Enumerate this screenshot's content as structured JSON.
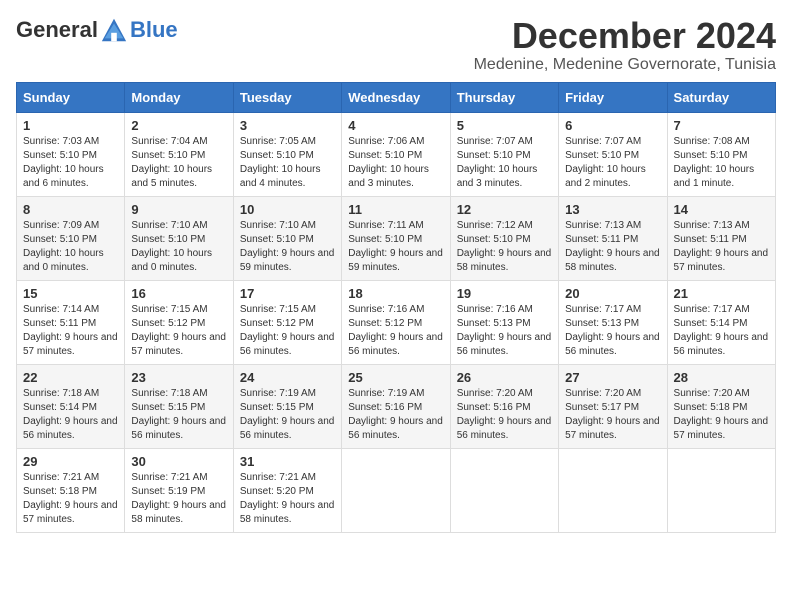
{
  "logo": {
    "general": "General",
    "blue": "Blue"
  },
  "header": {
    "month": "December 2024",
    "location": "Medenine, Medenine Governorate, Tunisia"
  },
  "weekdays": [
    "Sunday",
    "Monday",
    "Tuesday",
    "Wednesday",
    "Thursday",
    "Friday",
    "Saturday"
  ],
  "weeks": [
    [
      {
        "day": "1",
        "sunrise": "7:03 AM",
        "sunset": "5:10 PM",
        "daylight": "10 hours and 6 minutes."
      },
      {
        "day": "2",
        "sunrise": "7:04 AM",
        "sunset": "5:10 PM",
        "daylight": "10 hours and 5 minutes."
      },
      {
        "day": "3",
        "sunrise": "7:05 AM",
        "sunset": "5:10 PM",
        "daylight": "10 hours and 4 minutes."
      },
      {
        "day": "4",
        "sunrise": "7:06 AM",
        "sunset": "5:10 PM",
        "daylight": "10 hours and 3 minutes."
      },
      {
        "day": "5",
        "sunrise": "7:07 AM",
        "sunset": "5:10 PM",
        "daylight": "10 hours and 3 minutes."
      },
      {
        "day": "6",
        "sunrise": "7:07 AM",
        "sunset": "5:10 PM",
        "daylight": "10 hours and 2 minutes."
      },
      {
        "day": "7",
        "sunrise": "7:08 AM",
        "sunset": "5:10 PM",
        "daylight": "10 hours and 1 minute."
      }
    ],
    [
      {
        "day": "8",
        "sunrise": "7:09 AM",
        "sunset": "5:10 PM",
        "daylight": "10 hours and 0 minutes."
      },
      {
        "day": "9",
        "sunrise": "7:10 AM",
        "sunset": "5:10 PM",
        "daylight": "10 hours and 0 minutes."
      },
      {
        "day": "10",
        "sunrise": "7:10 AM",
        "sunset": "5:10 PM",
        "daylight": "9 hours and 59 minutes."
      },
      {
        "day": "11",
        "sunrise": "7:11 AM",
        "sunset": "5:10 PM",
        "daylight": "9 hours and 59 minutes."
      },
      {
        "day": "12",
        "sunrise": "7:12 AM",
        "sunset": "5:10 PM",
        "daylight": "9 hours and 58 minutes."
      },
      {
        "day": "13",
        "sunrise": "7:13 AM",
        "sunset": "5:11 PM",
        "daylight": "9 hours and 58 minutes."
      },
      {
        "day": "14",
        "sunrise": "7:13 AM",
        "sunset": "5:11 PM",
        "daylight": "9 hours and 57 minutes."
      }
    ],
    [
      {
        "day": "15",
        "sunrise": "7:14 AM",
        "sunset": "5:11 PM",
        "daylight": "9 hours and 57 minutes."
      },
      {
        "day": "16",
        "sunrise": "7:15 AM",
        "sunset": "5:12 PM",
        "daylight": "9 hours and 57 minutes."
      },
      {
        "day": "17",
        "sunrise": "7:15 AM",
        "sunset": "5:12 PM",
        "daylight": "9 hours and 56 minutes."
      },
      {
        "day": "18",
        "sunrise": "7:16 AM",
        "sunset": "5:12 PM",
        "daylight": "9 hours and 56 minutes."
      },
      {
        "day": "19",
        "sunrise": "7:16 AM",
        "sunset": "5:13 PM",
        "daylight": "9 hours and 56 minutes."
      },
      {
        "day": "20",
        "sunrise": "7:17 AM",
        "sunset": "5:13 PM",
        "daylight": "9 hours and 56 minutes."
      },
      {
        "day": "21",
        "sunrise": "7:17 AM",
        "sunset": "5:14 PM",
        "daylight": "9 hours and 56 minutes."
      }
    ],
    [
      {
        "day": "22",
        "sunrise": "7:18 AM",
        "sunset": "5:14 PM",
        "daylight": "9 hours and 56 minutes."
      },
      {
        "day": "23",
        "sunrise": "7:18 AM",
        "sunset": "5:15 PM",
        "daylight": "9 hours and 56 minutes."
      },
      {
        "day": "24",
        "sunrise": "7:19 AM",
        "sunset": "5:15 PM",
        "daylight": "9 hours and 56 minutes."
      },
      {
        "day": "25",
        "sunrise": "7:19 AM",
        "sunset": "5:16 PM",
        "daylight": "9 hours and 56 minutes."
      },
      {
        "day": "26",
        "sunrise": "7:20 AM",
        "sunset": "5:16 PM",
        "daylight": "9 hours and 56 minutes."
      },
      {
        "day": "27",
        "sunrise": "7:20 AM",
        "sunset": "5:17 PM",
        "daylight": "9 hours and 57 minutes."
      },
      {
        "day": "28",
        "sunrise": "7:20 AM",
        "sunset": "5:18 PM",
        "daylight": "9 hours and 57 minutes."
      }
    ],
    [
      {
        "day": "29",
        "sunrise": "7:21 AM",
        "sunset": "5:18 PM",
        "daylight": "9 hours and 57 minutes."
      },
      {
        "day": "30",
        "sunrise": "7:21 AM",
        "sunset": "5:19 PM",
        "daylight": "9 hours and 58 minutes."
      },
      {
        "day": "31",
        "sunrise": "7:21 AM",
        "sunset": "5:20 PM",
        "daylight": "9 hours and 58 minutes."
      },
      null,
      null,
      null,
      null
    ]
  ],
  "labels": {
    "sunrise": "Sunrise:",
    "sunset": "Sunset:",
    "daylight": "Daylight:"
  }
}
